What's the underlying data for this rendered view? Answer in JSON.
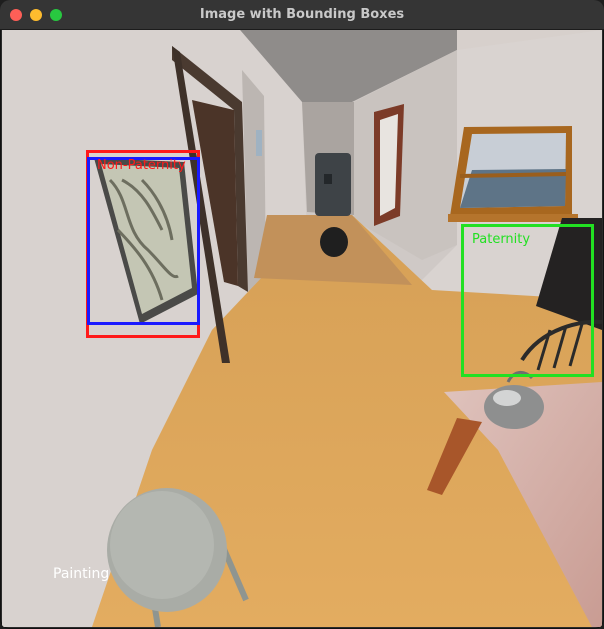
{
  "window": {
    "title": "Image with Bounding Boxes"
  },
  "detections": [
    {
      "label": "Non-Paternity",
      "color": "#ff1a1a"
    },
    {
      "label": "",
      "color": "#1a1aff"
    },
    {
      "label": "Paternity",
      "color": "#22e022"
    }
  ],
  "caption": "Painting"
}
